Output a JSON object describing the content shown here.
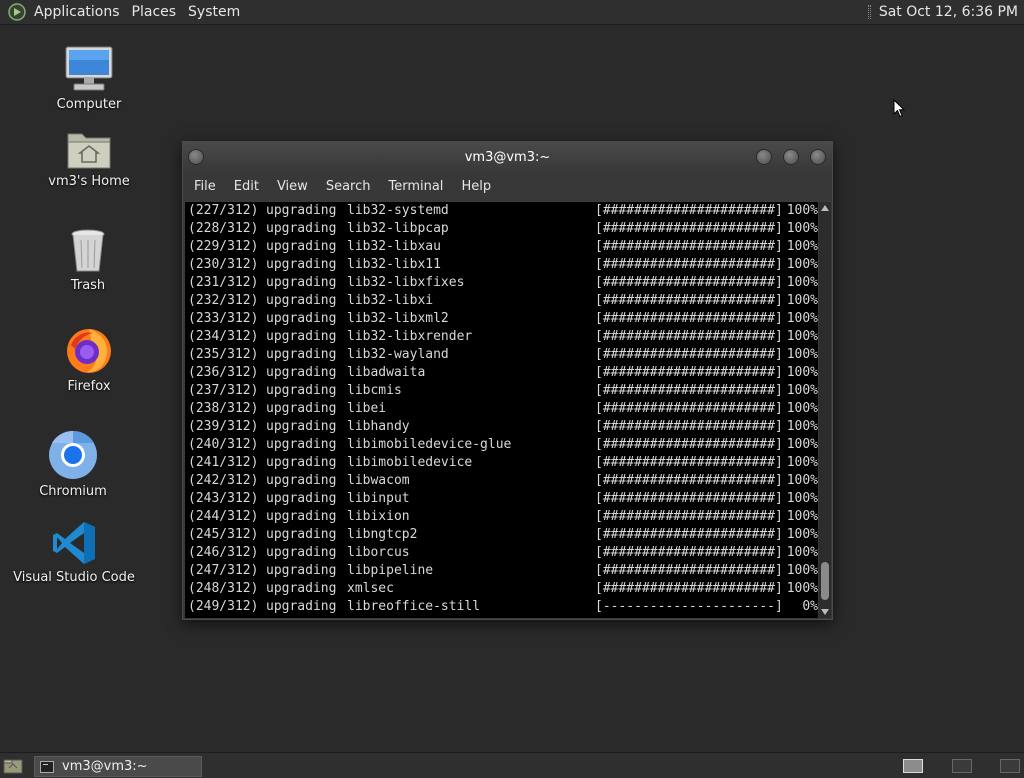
{
  "top_panel": {
    "menus": [
      "Applications",
      "Places",
      "System"
    ],
    "clock": "Sat Oct 12,  6:36 PM"
  },
  "desktop_icons": [
    {
      "label": "Computer",
      "icon": "computer-icon"
    },
    {
      "label": "vm3's Home",
      "icon": "home-folder-icon"
    },
    {
      "label": "Trash",
      "icon": "trash-icon"
    },
    {
      "label": "Firefox",
      "icon": "firefox-icon"
    },
    {
      "label": "Chromium",
      "icon": "chromium-icon"
    },
    {
      "label": "Visual Studio Code",
      "icon": "vscode-icon"
    }
  ],
  "terminal": {
    "title": "vm3@vm3:~",
    "menus": [
      "File",
      "Edit",
      "View",
      "Search",
      "Terminal",
      "Help"
    ],
    "lines": [
      {
        "idx": "(227/312)",
        "action": "upgrading",
        "pkg": "lib32-systemd",
        "bar": "[######################]",
        "pct": "100%"
      },
      {
        "idx": "(228/312)",
        "action": "upgrading",
        "pkg": "lib32-libpcap",
        "bar": "[######################]",
        "pct": "100%"
      },
      {
        "idx": "(229/312)",
        "action": "upgrading",
        "pkg": "lib32-libxau",
        "bar": "[######################]",
        "pct": "100%"
      },
      {
        "idx": "(230/312)",
        "action": "upgrading",
        "pkg": "lib32-libx11",
        "bar": "[######################]",
        "pct": "100%"
      },
      {
        "idx": "(231/312)",
        "action": "upgrading",
        "pkg": "lib32-libxfixes",
        "bar": "[######################]",
        "pct": "100%"
      },
      {
        "idx": "(232/312)",
        "action": "upgrading",
        "pkg": "lib32-libxi",
        "bar": "[######################]",
        "pct": "100%"
      },
      {
        "idx": "(233/312)",
        "action": "upgrading",
        "pkg": "lib32-libxml2",
        "bar": "[######################]",
        "pct": "100%"
      },
      {
        "idx": "(234/312)",
        "action": "upgrading",
        "pkg": "lib32-libxrender",
        "bar": "[######################]",
        "pct": "100%"
      },
      {
        "idx": "(235/312)",
        "action": "upgrading",
        "pkg": "lib32-wayland",
        "bar": "[######################]",
        "pct": "100%"
      },
      {
        "idx": "(236/312)",
        "action": "upgrading",
        "pkg": "libadwaita",
        "bar": "[######################]",
        "pct": "100%"
      },
      {
        "idx": "(237/312)",
        "action": "upgrading",
        "pkg": "libcmis",
        "bar": "[######################]",
        "pct": "100%"
      },
      {
        "idx": "(238/312)",
        "action": "upgrading",
        "pkg": "libei",
        "bar": "[######################]",
        "pct": "100%"
      },
      {
        "idx": "(239/312)",
        "action": "upgrading",
        "pkg": "libhandy",
        "bar": "[######################]",
        "pct": "100%"
      },
      {
        "idx": "(240/312)",
        "action": "upgrading",
        "pkg": "libimobiledevice-glue",
        "bar": "[######################]",
        "pct": "100%"
      },
      {
        "idx": "(241/312)",
        "action": "upgrading",
        "pkg": "libimobiledevice",
        "bar": "[######################]",
        "pct": "100%"
      },
      {
        "idx": "(242/312)",
        "action": "upgrading",
        "pkg": "libwacom",
        "bar": "[######################]",
        "pct": "100%"
      },
      {
        "idx": "(243/312)",
        "action": "upgrading",
        "pkg": "libinput",
        "bar": "[######################]",
        "pct": "100%"
      },
      {
        "idx": "(244/312)",
        "action": "upgrading",
        "pkg": "libixion",
        "bar": "[######################]",
        "pct": "100%"
      },
      {
        "idx": "(245/312)",
        "action": "upgrading",
        "pkg": "libngtcp2",
        "bar": "[######################]",
        "pct": "100%"
      },
      {
        "idx": "(246/312)",
        "action": "upgrading",
        "pkg": "liborcus",
        "bar": "[######################]",
        "pct": "100%"
      },
      {
        "idx": "(247/312)",
        "action": "upgrading",
        "pkg": "libpipeline",
        "bar": "[######################]",
        "pct": "100%"
      },
      {
        "idx": "(248/312)",
        "action": "upgrading",
        "pkg": "xmlsec",
        "bar": "[######################]",
        "pct": "100%"
      },
      {
        "idx": "(249/312)",
        "action": "upgrading",
        "pkg": "libreoffice-still",
        "bar": "[----------------------]",
        "pct": "0%"
      }
    ]
  },
  "taskbar": {
    "window_button": "vm3@vm3:~"
  }
}
